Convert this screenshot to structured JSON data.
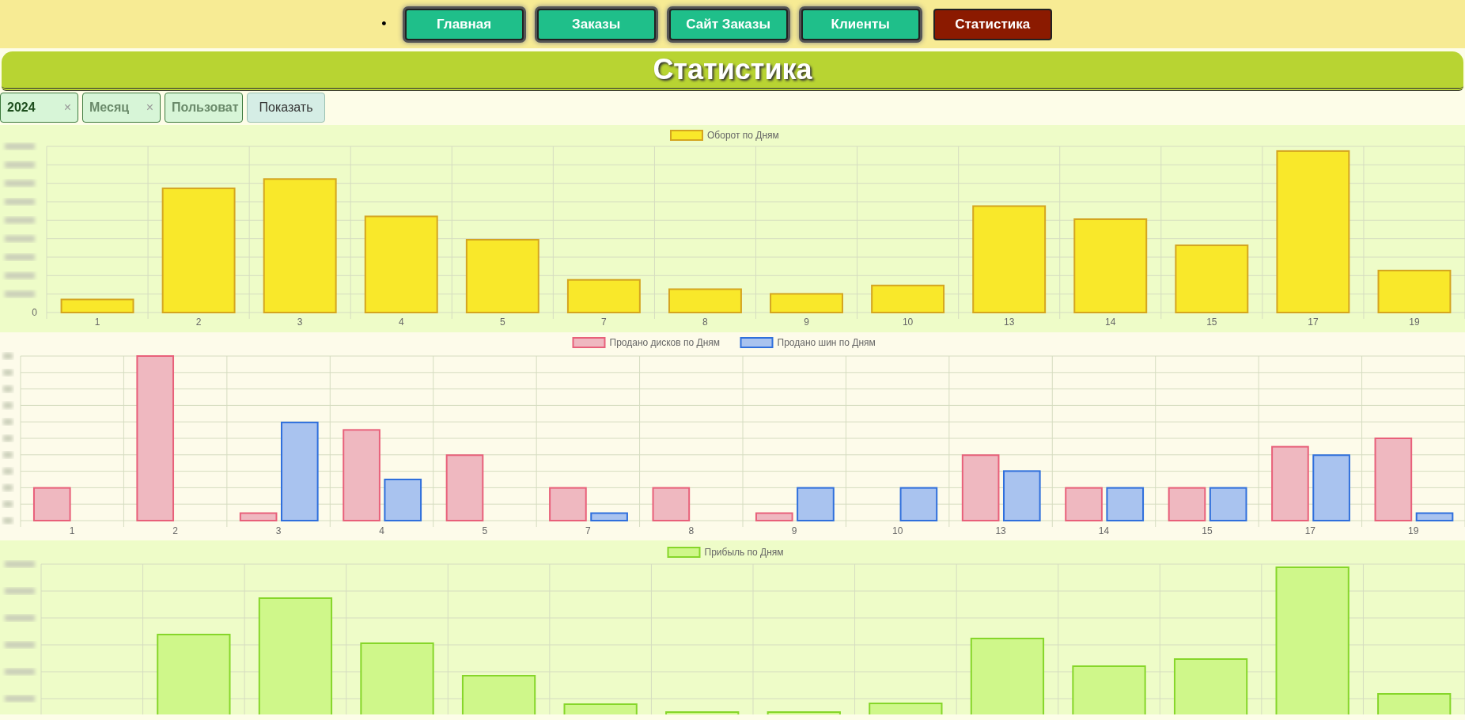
{
  "nav": {
    "bullet": "•",
    "items": [
      {
        "label": "Главная",
        "selected": false
      },
      {
        "label": "Заказы",
        "selected": false
      },
      {
        "label": "Сайт Заказы",
        "selected": false
      },
      {
        "label": "Клиенты",
        "selected": false
      },
      {
        "label": "Статистика",
        "selected": true
      }
    ]
  },
  "header": {
    "title": "Статистика"
  },
  "filters": [
    {
      "value": "2024",
      "clear": "×"
    },
    {
      "placeholder": "Месяц",
      "clear": "×"
    },
    {
      "placeholder": "Пользоват"
    }
  ],
  "show_button": "Показать",
  "charts": [
    {
      "legend": [
        {
          "label": "Оборот по Дням",
          "color": "#f9e82a"
        }
      ],
      "zero_label": "0",
      "categories": [
        "1",
        "2",
        "3",
        "4",
        "5",
        "7",
        "8",
        "9",
        "10",
        "13",
        "14",
        "15",
        "17",
        "19"
      ]
    },
    {
      "legend": [
        {
          "label": "Продано дисков по Дням",
          "color": "#efb8c0"
        },
        {
          "label": "Продано шин по Дням",
          "color": "#a9c3ef"
        }
      ],
      "categories": [
        "1",
        "2",
        "3",
        "4",
        "5",
        "7",
        "8",
        "9",
        "10",
        "13",
        "14",
        "15",
        "17",
        "19"
      ]
    },
    {
      "legend": [
        {
          "label": "Прибыль по Дням",
          "color": "#cff78a"
        }
      ]
    }
  ]
}
